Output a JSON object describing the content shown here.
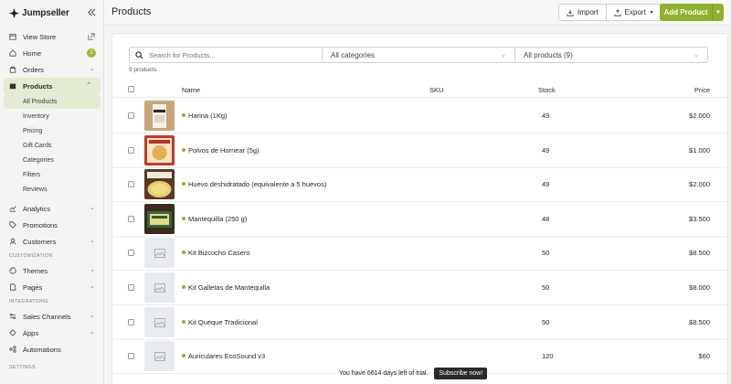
{
  "brand": {
    "name": "Jumpseller",
    "accent": "#90b12e"
  },
  "header": {
    "title": "Products",
    "import_label": "Import",
    "export_label": "Export",
    "add_label": "Add Product"
  },
  "sidebar": {
    "top": [
      {
        "label": "View Store",
        "icon": "store-icon"
      },
      {
        "label": "Home",
        "icon": "home-icon",
        "badge": "1"
      },
      {
        "label": "Orders",
        "icon": "orders-icon"
      },
      {
        "label": "Products",
        "icon": "products-icon"
      }
    ],
    "products_sub": [
      "All Products",
      "Inventory",
      "Pricing",
      "Gift Cards",
      "Categories",
      "Filters",
      "Reviews"
    ],
    "more": [
      {
        "label": "Analytics",
        "icon": "analytics-icon"
      },
      {
        "label": "Promotions",
        "icon": "promotions-icon"
      },
      {
        "label": "Customers",
        "icon": "customers-icon"
      }
    ],
    "section_customization": "CUSTOMIZATION",
    "customization": [
      {
        "label": "Themes",
        "icon": "themes-icon"
      },
      {
        "label": "Pages",
        "icon": "pages-icon"
      }
    ],
    "section_integrations": "INTEGRATIONS",
    "integrations": [
      {
        "label": "Sales Channels",
        "icon": "sales-channels-icon"
      },
      {
        "label": "Apps",
        "icon": "apps-icon"
      },
      {
        "label": "Automations",
        "icon": "automations-icon"
      }
    ],
    "section_settings": "SETTINGS"
  },
  "filters": {
    "search_placeholder": "Search for Products...",
    "category": "All categories",
    "products": "All products (9)"
  },
  "count_label": "9 products",
  "table": {
    "columns": {
      "name": "Name",
      "sku": "SKU",
      "stock": "Stock",
      "price": "Price"
    },
    "rows": [
      {
        "name": "Harina (1Kg)",
        "stock": "49",
        "price": "$2.000",
        "thumb": "flour-bag-image"
      },
      {
        "name": "Polvos de Hornear (5g)",
        "stock": "49",
        "price": "$1.000",
        "thumb": "baking-powder-image"
      },
      {
        "name": "Huevo deshidratado (equivalente a 5 huevos)",
        "stock": "49",
        "price": "$2.000",
        "thumb": "dried-egg-image"
      },
      {
        "name": "Mantequilla (250 g)",
        "stock": "48",
        "price": "$3.500",
        "thumb": "butter-image"
      },
      {
        "name": "Kit Bizcocho Casero",
        "stock": "50",
        "price": "$8.500",
        "thumb": "placeholder-image-icon"
      },
      {
        "name": "Kit Galletas de Mantequilla",
        "stock": "50",
        "price": "$8.000",
        "thumb": "placeholder-image-icon"
      },
      {
        "name": "Kit Queque Tradicional",
        "stock": "50",
        "price": "$8.500",
        "thumb": "placeholder-image-icon"
      },
      {
        "name": "Auriculares EcoSound v3",
        "stock": "120",
        "price": "$60",
        "thumb": "placeholder-image-icon"
      }
    ]
  },
  "trial": {
    "message": "You have 6614 days left of trial.",
    "button": "Subscribe now!"
  }
}
